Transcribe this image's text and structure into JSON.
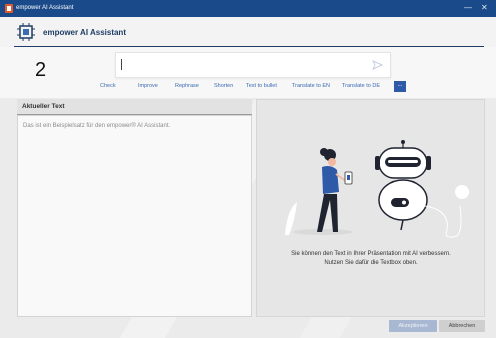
{
  "window": {
    "title": "empower AI Assistant",
    "controls": {
      "minimize": "—",
      "close": "✕"
    }
  },
  "header": {
    "title": "empower AI Assistant"
  },
  "step_number": "2",
  "prompt": {
    "value": "",
    "send_icon": "send-icon"
  },
  "actions": [
    "Check",
    "Improve",
    "Rephrase",
    "Shorten",
    "Text to bullet",
    "Translate to EN",
    "Translate to DE",
    "..."
  ],
  "left_panel": {
    "title": "Aktueller Text",
    "content": "Das ist ein Beispielsatz für den empower® AI Assistant."
  },
  "right_panel": {
    "message_line1": "Sie können den Text in Ihrer Präsentation mit AI verbessern.",
    "message_line2": "Nutzen Sie dafür die Textbox oben."
  },
  "buttons": {
    "accept": "Akzeptieren",
    "cancel": "Abbrechen"
  },
  "colors": {
    "titlebar": "#1a4a8a",
    "brand": "#1e3c66",
    "action_text": "#3a6ab2",
    "accent": "#2e5aa8",
    "accept_disabled": "#a9b8d2"
  }
}
